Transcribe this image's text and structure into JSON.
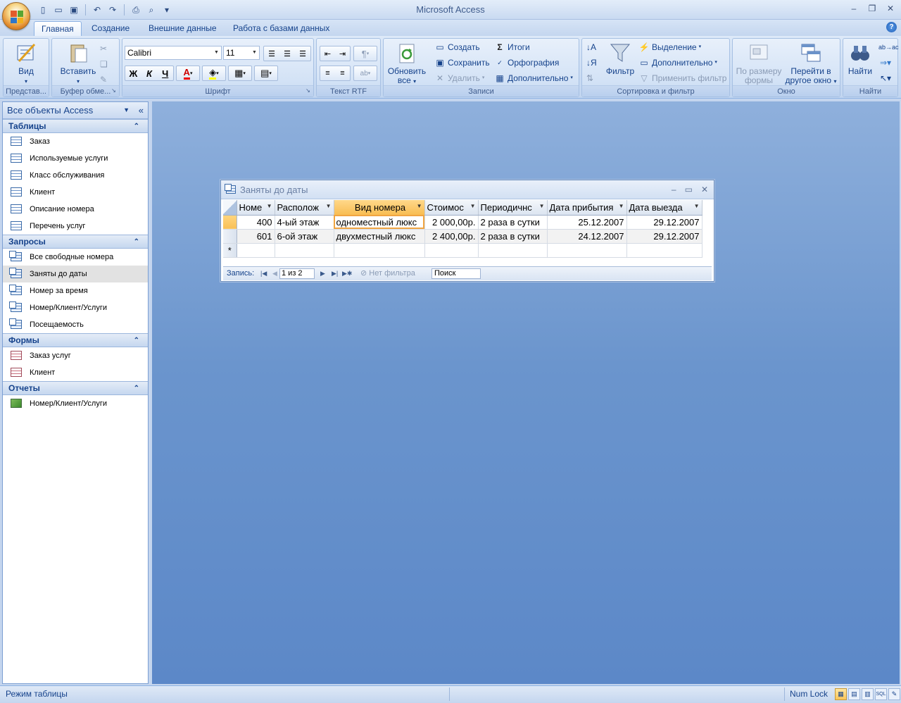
{
  "window": {
    "title": "Microsoft Access",
    "help": "?"
  },
  "qat": {
    "icons": [
      "new-icon",
      "open-icon",
      "save-icon",
      "undo-icon",
      "redo-icon",
      "print-icon",
      "print-preview-icon",
      "customize-icon"
    ]
  },
  "tabs": [
    "Главная",
    "Создание",
    "Внешние данные",
    "Работа с базами данных"
  ],
  "ribbon": {
    "views": {
      "label": "Вид",
      "group": "Представ..."
    },
    "clipboard": {
      "paste": "Вставить",
      "group": "Буфер обме..."
    },
    "font": {
      "family": "Calibri",
      "size": "11",
      "bold": "Ж",
      "italic": "К",
      "underline": "Ч",
      "group": "Шрифт"
    },
    "rtf": {
      "group": "Текст RTF"
    },
    "records": {
      "refresh": "Обновить",
      "refresh2": "все",
      "new": "Создать",
      "save": "Сохранить",
      "delete": "Удалить",
      "totals": "Итоги",
      "spelling": "Орфография",
      "more": "Дополнительно",
      "group": "Записи"
    },
    "sort": {
      "filter": "Фильтр",
      "selection": "Выделение",
      "advanced": "Дополнительно",
      "toggle": "Применить фильтр",
      "group": "Сортировка и фильтр"
    },
    "window": {
      "fit1": "По размеру",
      "fit2": "формы",
      "switch1": "Перейти в",
      "switch2": "другое окно",
      "group": "Окно"
    },
    "find": {
      "find": "Найти",
      "group": "Найти"
    }
  },
  "nav": {
    "title": "Все объекты Access",
    "sections": [
      {
        "title": "Таблицы",
        "items": [
          "Заказ",
          "Используемые услуги",
          "Класс обслуживания",
          "Клиент",
          "Описание номера",
          "Перечень услуг"
        ]
      },
      {
        "title": "Запросы",
        "items": [
          "Все свободные номера",
          "Заняты до даты",
          "Номер за время",
          "Номер/Клиент/Услуги",
          "Посещаемость"
        ]
      },
      {
        "title": "Формы",
        "items": [
          "Заказ услуг",
          "Клиент"
        ]
      },
      {
        "title": "Отчеты",
        "items": [
          "Номер/Клиент/Услуги"
        ]
      }
    ]
  },
  "doc": {
    "title": "Заняты до даты",
    "columns": [
      "Номе",
      "Располож",
      "Вид номера",
      "Стоимос",
      "Периодичнс",
      "Дата прибытия",
      "Дата выезда"
    ],
    "rows": [
      [
        "400",
        "4-ый этаж",
        "одноместный люкс",
        "2 000,00р.",
        "2 раза в сутки",
        "25.12.2007",
        "29.12.2007"
      ],
      [
        "601",
        "6-ой этаж",
        "двухместный люкс",
        "2 400,00р.",
        "2 раза в сутки",
        "24.12.2007",
        "29.12.2007"
      ]
    ],
    "new_row_marker": "*",
    "recnav": {
      "label": "Запись:",
      "position": "1 из 2",
      "filter": "Нет фильтра",
      "search": "Поиск"
    }
  },
  "status": {
    "left": "Режим таблицы",
    "numlock": "Num Lock",
    "view_icons": [
      "datasheet-view-icon",
      "pivot-table-icon",
      "pivot-chart-icon",
      "sql-view-icon",
      "design-view-icon"
    ]
  },
  "colors": {
    "accent": "#15428b",
    "workspace": "#6b95cd",
    "highlight": "#f8bd52"
  }
}
